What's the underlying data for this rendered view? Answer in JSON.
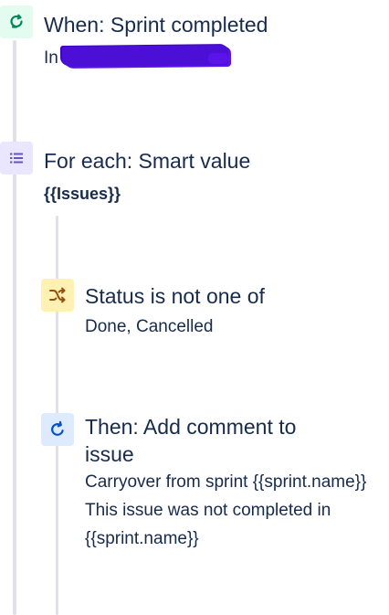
{
  "rule": {
    "trigger": {
      "icon": "refresh-arrow-icon",
      "color": "#00875a",
      "title": "When: Sprint completed",
      "subtitle_visible": "In"
    },
    "branch": {
      "icon": "list-icon",
      "color": "#6554c0",
      "title": "For each: Smart value",
      "subtitle": "{{Issues}}"
    },
    "condition": {
      "icon": "shuffle-icon",
      "color": "#ff8b00",
      "title": "Status is not one of",
      "subtitle": "Done, Cancelled"
    },
    "action": {
      "icon": "rotate-arrow-icon",
      "color": "#0052cc",
      "title": "Then: Add comment to issue",
      "subtitle": "Carryover from sprint {{sprint.name}} This issue was not completed in {{sprint.name}}"
    }
  }
}
